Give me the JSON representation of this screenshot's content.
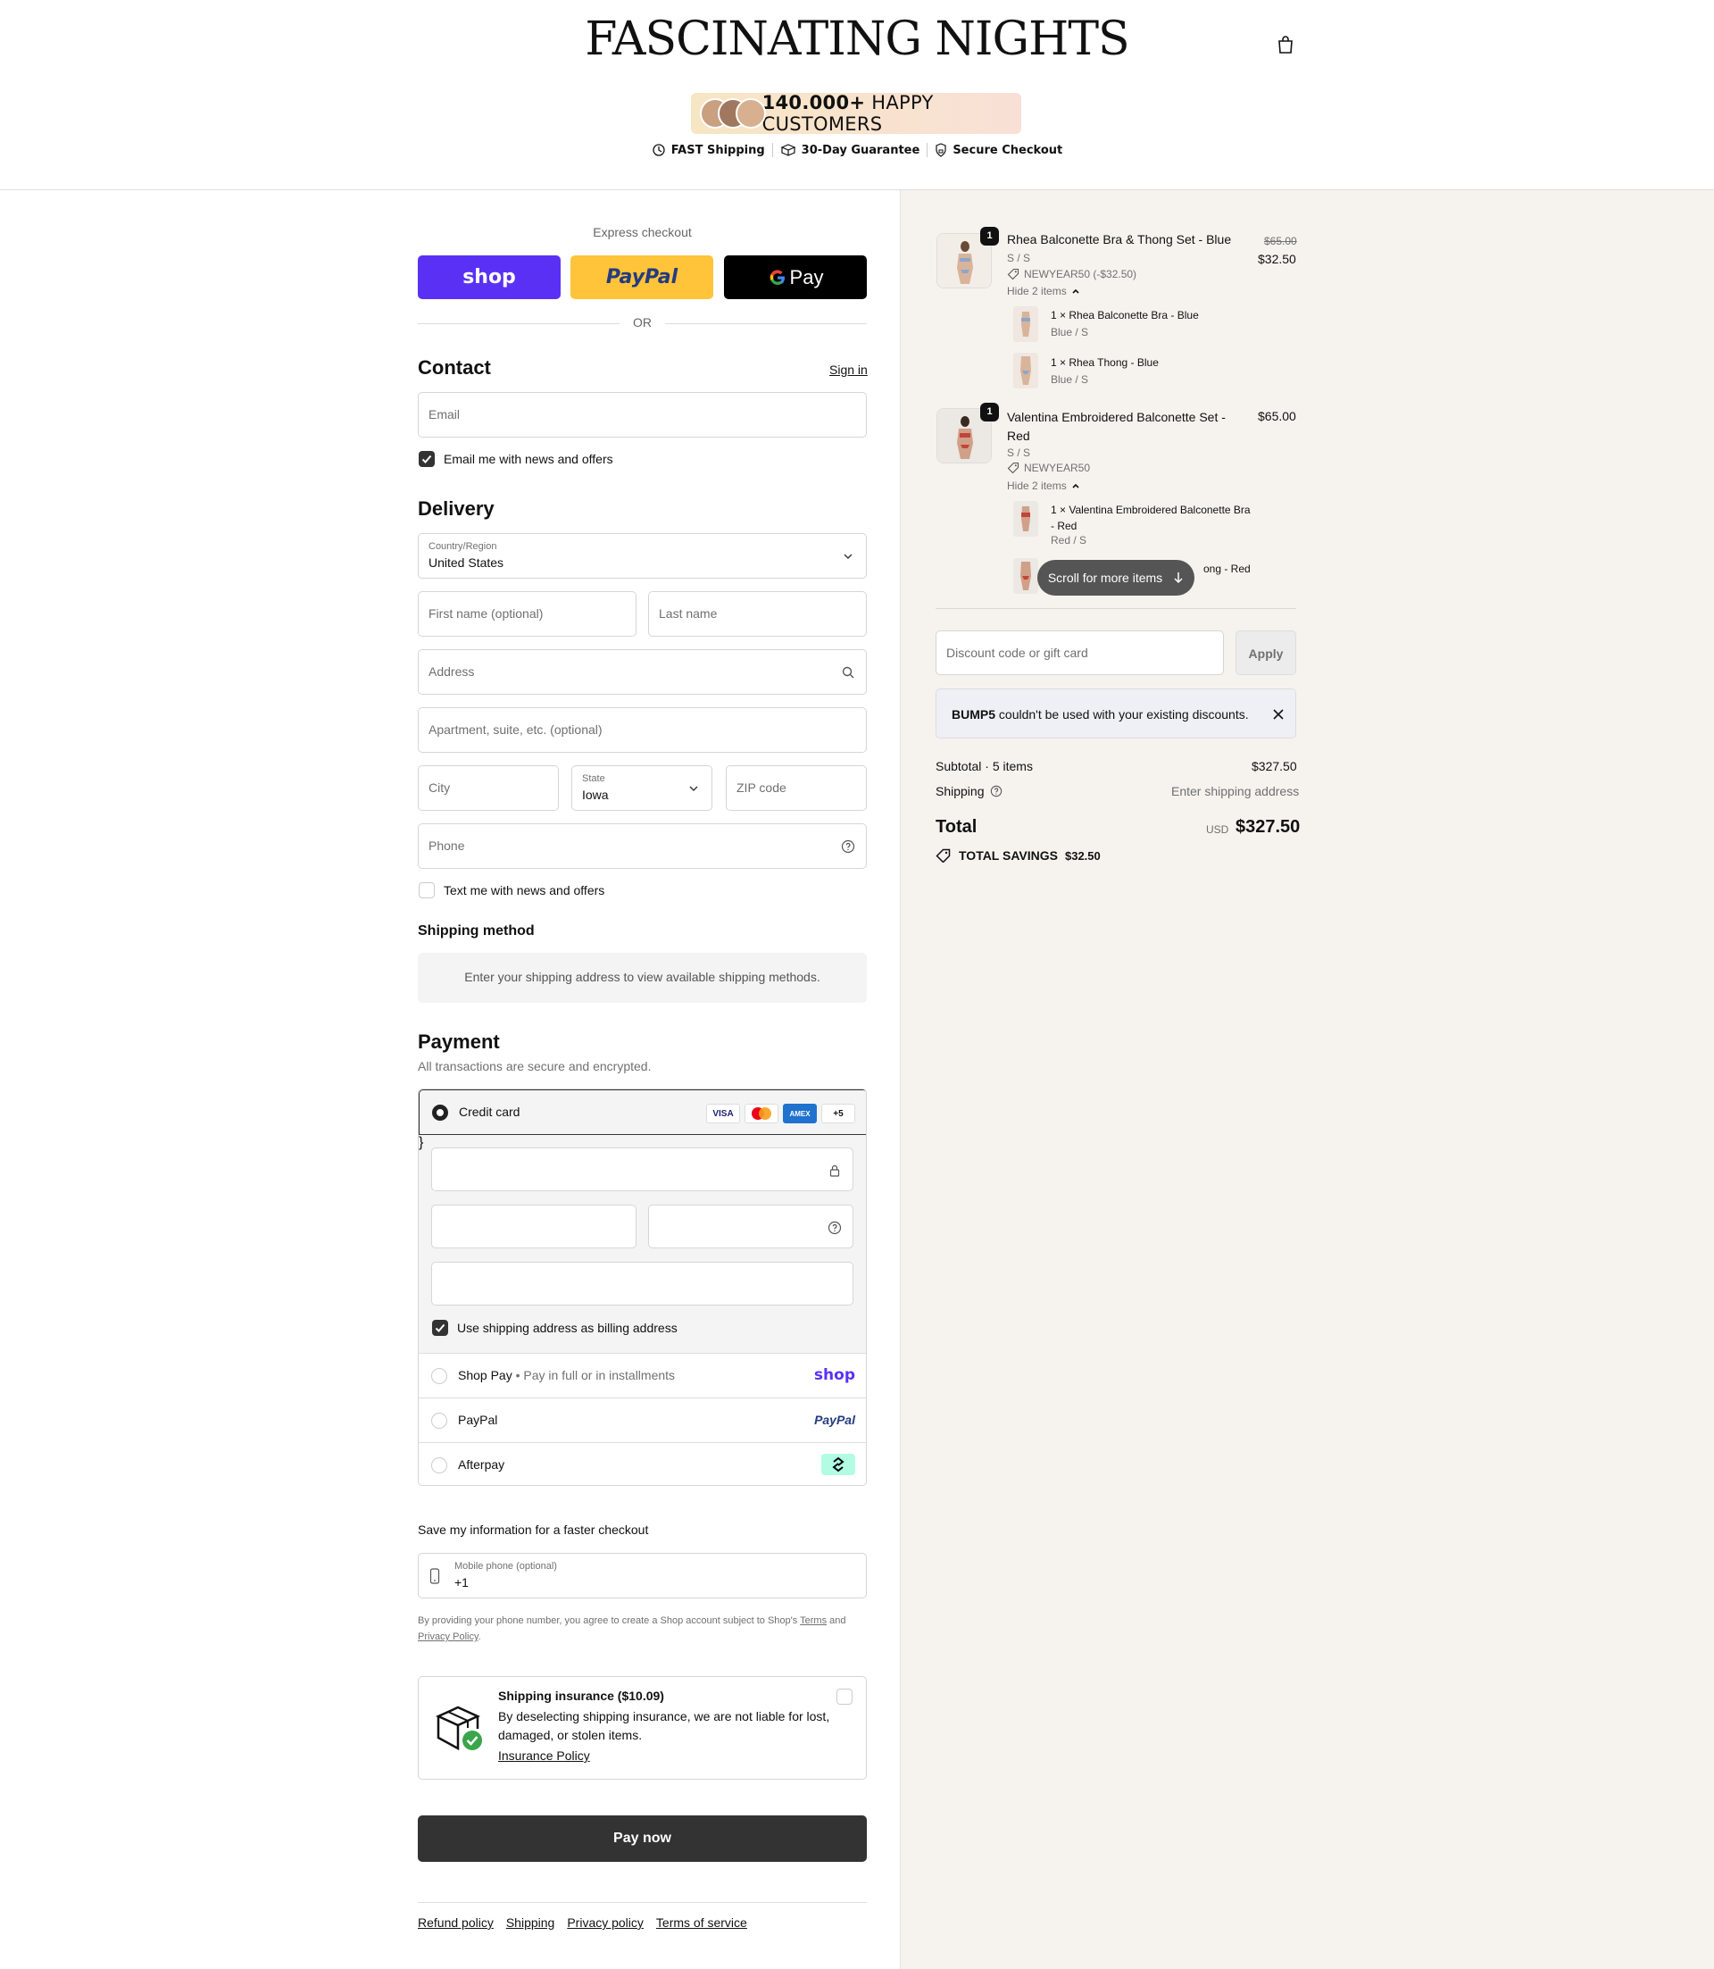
{
  "header": {
    "brand": "FASCINATING NIGHTS",
    "promo_count": "140.000+",
    "promo_text": "HAPPY CUSTOMERS",
    "trust": [
      "FAST Shipping",
      "30-Day Guarantee",
      "Secure Checkout"
    ]
  },
  "express": {
    "label": "Express checkout",
    "shop_label": "shop",
    "paypal_label": "PayPal",
    "gpay_label": "Pay",
    "or_label": "OR"
  },
  "contact": {
    "title": "Contact",
    "sign_in": "Sign in",
    "email_placeholder": "Email",
    "news_label": "Email me with news and offers",
    "news_checked": true
  },
  "delivery": {
    "title": "Delivery",
    "country_label": "Country/Region",
    "country_value": "United States",
    "first_name_placeholder": "First name (optional)",
    "last_name_placeholder": "Last name",
    "address_placeholder": "Address",
    "apartment_placeholder": "Apartment, suite, etc. (optional)",
    "city_placeholder": "City",
    "state_label": "State",
    "state_value": "Iowa",
    "zip_placeholder": "ZIP code",
    "phone_placeholder": "Phone",
    "text_label": "Text me with news and offers",
    "text_checked": false
  },
  "shipping_method": {
    "title": "Shipping method",
    "message": "Enter your shipping address to view available shipping methods."
  },
  "payment": {
    "title": "Payment",
    "subtitle": "All transactions are secure and encrypted.",
    "credit_card_label": "Credit card",
    "card_logos": [
      "VISA",
      "MC",
      "AMEX",
      "+5"
    ],
    "billing_label": "Use shipping address as billing address",
    "billing_checked": true,
    "shop_pay_label": "Shop Pay",
    "shop_pay_sub": "Pay in full or in installments",
    "shop_pay_logo": "shop",
    "paypal_label": "PayPal",
    "paypal_logo": "PayPal",
    "afterpay_label": "Afterpay"
  },
  "save_info": {
    "title": "Save my information for a faster checkout",
    "mobile_label": "Mobile phone (optional)",
    "mobile_value": "+1",
    "disclaimer_1": "By providing your phone number, you agree to create a Shop account subject to Shop's",
    "terms_link": "Terms",
    "disclaimer_2": "and",
    "privacy_link": "Privacy Policy",
    "disclaimer_3": "."
  },
  "insurance": {
    "title": "Shipping insurance ($10.09)",
    "text": "By deselecting shipping insurance, we are not liable for lost, damaged, or stolen items.",
    "policy_link": "Insurance Policy"
  },
  "pay_now": "Pay now",
  "footer": [
    "Refund policy",
    "Shipping",
    "Privacy policy",
    "Terms of service"
  ],
  "cart": {
    "items": [
      {
        "qty": "1",
        "name": "Rhea Balconette Bra & Thong Set - Blue",
        "variant": "S / S",
        "discount": "NEWYEAR50 (-$32.50)",
        "old_price": "$65.00",
        "price": "$32.50",
        "hide_label": "Hide 2 items",
        "sub": [
          {
            "name": "1 × Rhea Balconette Bra - Blue",
            "variant": "Blue / S"
          },
          {
            "name": "1 × Rhea Thong - Blue",
            "variant": "Blue / S"
          }
        ]
      },
      {
        "qty": "1",
        "name": "Valentina Embroidered Balconette Set - Red",
        "variant": "S / S",
        "discount": "NEWYEAR50",
        "price": "$65.00",
        "hide_label": "Hide 2 items",
        "sub": [
          {
            "name": "1 × Valentina Embroidered Balconette Bra - Red",
            "variant": "Red / S"
          },
          {
            "name": "ong - Red",
            "variant": ""
          }
        ]
      }
    ],
    "scroll_hint": "Scroll for more items",
    "discount_placeholder": "Discount code or gift card",
    "apply": "Apply",
    "notice_code": "BUMP5",
    "notice_text": "couldn't be used with your existing discounts.",
    "subtotal_label": "Subtotal · 5 items",
    "subtotal_value": "$327.50",
    "shipping_label": "Shipping",
    "shipping_value": "Enter shipping address",
    "total_label": "Total",
    "currency": "USD",
    "total_value": "$327.50",
    "savings_label": "TOTAL SAVINGS",
    "savings_value": "$32.50"
  },
  "colors": {
    "shop_purple": "#5a31f4",
    "paypal_yellow": "#ffc439",
    "right_panel": "#f6f3ee",
    "dark_button": "#333333"
  }
}
